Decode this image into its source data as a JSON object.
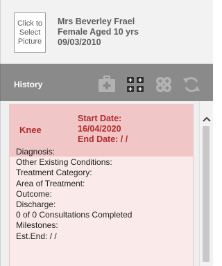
{
  "patient": {
    "picture_label_line1": "Click to",
    "picture_label_line2": "Select",
    "picture_label_line3": "Picture",
    "name": "Mrs Beverley Frael",
    "summary": "Female Aged 10 yrs",
    "dob": "09/03/2010"
  },
  "toolbar": {
    "title": "History",
    "icons": [
      "medical-kit-icon",
      "grid-add-icon",
      "group-add-icon",
      "refresh-icon"
    ]
  },
  "episode": {
    "title": "Knee",
    "start_label": "Start Date:",
    "start_value": "16/04/2020",
    "end_label": "End Date: / /",
    "fields": [
      "Diagnosis:",
      "Other Existing Conditions:",
      "Treatment Category:",
      "Area of Treatment:",
      "Outcome:",
      "Discharge:",
      "0 of 0 Consultations Completed",
      "Milestones:",
      "Est.End: / /"
    ]
  },
  "colors": {
    "toolbar_bg": "#8a8a8a",
    "card_header_bg": "#f1c6c6",
    "card_bg": "#fbeaea",
    "accent_red": "#b22a2a"
  }
}
